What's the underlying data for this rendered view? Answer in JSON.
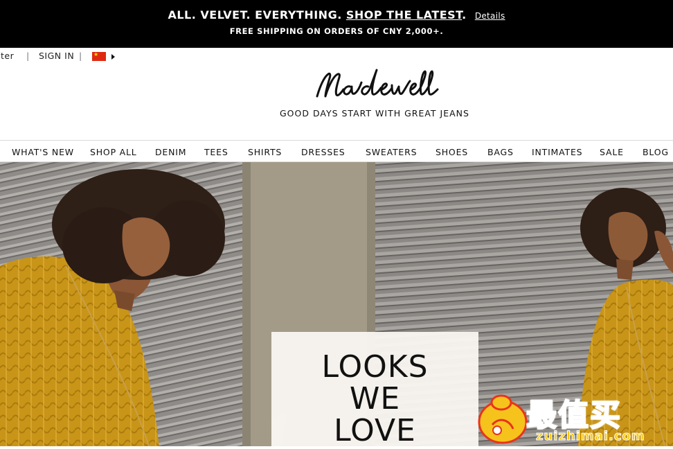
{
  "promo": {
    "line1_main": "ALL. VELVET. EVERYTHING.",
    "line1_link": "SHOP THE LATEST",
    "line1_period": ".",
    "details_link": "Details",
    "line2": "FREE SHIPPING ON ORDERS OF CNY 2,000+."
  },
  "utility": {
    "register": "ister",
    "separator": "|",
    "signin": "SIGN IN",
    "flag_icon": "china-flag-icon",
    "caret_icon": "caret-right-icon"
  },
  "brand": {
    "logo_text": "Madewell",
    "tagline": "GOOD DAYS START WITH GREAT JEANS"
  },
  "nav": {
    "items": [
      "WHAT'S NEW",
      "SHOP ALL",
      "DENIM",
      "TEES",
      "SHIRTS",
      "DRESSES",
      "SWEATERS",
      "SHOES",
      "BAGS",
      "INTIMATES",
      "SALE",
      "BLOG"
    ]
  },
  "hero": {
    "headline_line1": "LOOKS",
    "headline_line2": "WE",
    "headline_line3": "LOVE"
  },
  "watermark": {
    "text": "最值买",
    "url": "zuizhimai.com"
  },
  "colors": {
    "promo_bg": "#000000",
    "mustard": "#c9981e",
    "shutter": "#8a8784",
    "concrete": "#a09886"
  }
}
